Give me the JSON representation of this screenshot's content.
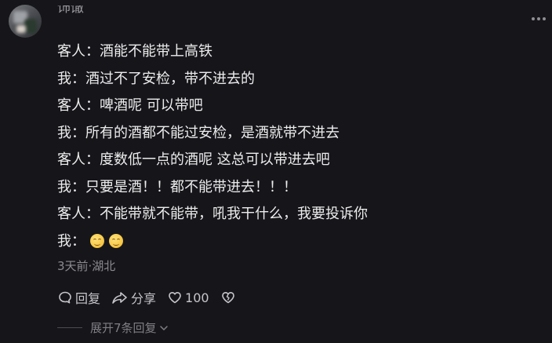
{
  "comment": {
    "username": "饰馓",
    "lines": [
      "客人：酒能不能带上高铁",
      "我：酒过不了安检，带不进去的",
      "客人：啤酒呢 可以带吧",
      "我：所有的酒都不能过安检，是酒就带不进去",
      "客人：度数低一点的酒呢 这总可以带进去吧",
      "我：只要是酒！！都不能带进去！！！",
      "客人：不能带就不能带，吼我干什么，我要投诉你",
      "我："
    ],
    "emojis": [
      "grinning-face-icon",
      "grinning-face-icon"
    ],
    "meta": "3天前·湖北"
  },
  "actions": {
    "reply_label": "回复",
    "share_label": "分享",
    "like_count": "100"
  },
  "replies": {
    "expand_label": "展开7条回复"
  }
}
